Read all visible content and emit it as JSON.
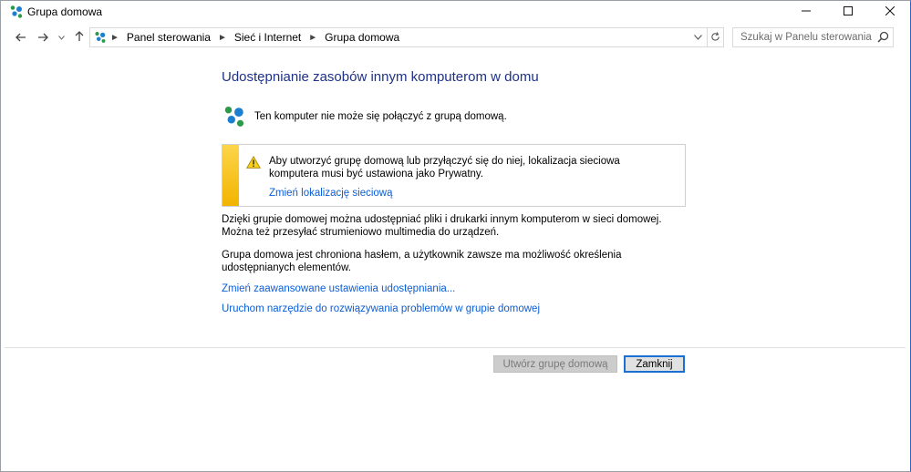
{
  "window": {
    "title": "Grupa domowa",
    "controls": {
      "minimize": "minimize-icon",
      "maximize": "maximize-icon",
      "close": "close-icon"
    }
  },
  "nav": {
    "breadcrumb": [
      "Panel sterowania",
      "Sieć i Internet",
      "Grupa domowa"
    ],
    "search_placeholder": "Szukaj w Panelu sterowania"
  },
  "main": {
    "heading": "Udostępnianie zasobów innym komputerom w domu",
    "status_text": "Ten komputer nie może się połączyć z grupą domową.",
    "warning": {
      "text": "Aby utworzyć grupę domową lub przyłączyć się do niej, lokalizacja sieciowa komputera musi być ustawiona jako Prywatny.",
      "link": "Zmień lokalizację sieciową",
      "stripe_color": "#f5c518"
    },
    "paragraph1": "Dzięki grupie domowej można udostępniać pliki i drukarki innym komputerom w sieci domowej. Można też przesyłać strumieniowo multimedia do urządzeń.",
    "paragraph2": "Grupa domowa jest chroniona hasłem, a użytkownik zawsze ma możliwość określenia udostępnianych elementów.",
    "link_advanced": "Zmień zaawansowane ustawienia udostępniania...",
    "link_troubleshoot": "Uruchom narzędzie do rozwiązywania problemów w grupie domowej"
  },
  "footer": {
    "create_button": "Utwórz grupę domową",
    "close_button": "Zamknij"
  },
  "colors": {
    "heading": "#1e3287",
    "link": "#0b5ed7",
    "accent_border": "#1a6fd4"
  }
}
